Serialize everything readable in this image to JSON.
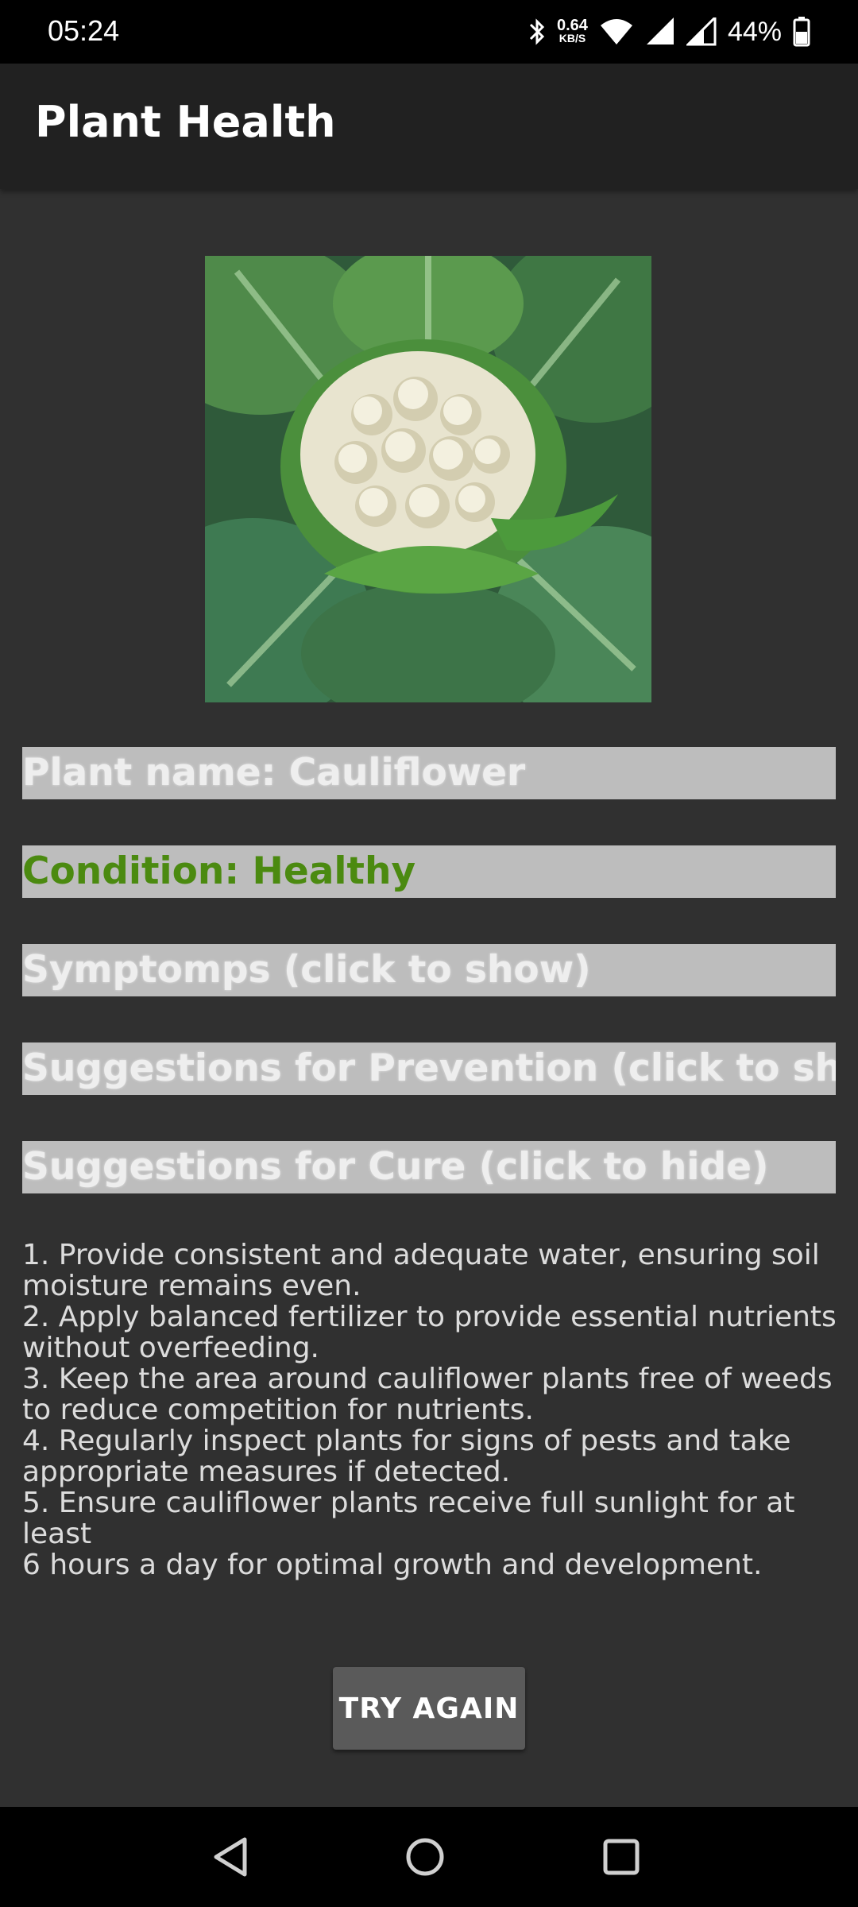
{
  "status_bar": {
    "time": "05:24",
    "net_speed_value": "0.64",
    "net_speed_unit": "KB/S",
    "battery_percent": "44%",
    "icons": [
      "bluetooth-icon",
      "wifi-icon",
      "signal-icon",
      "signal-icon-2",
      "battery-icon"
    ]
  },
  "app_bar": {
    "title": "Plant Health"
  },
  "result": {
    "plant_name_prefix": "Plant name: ",
    "plant_name": "Cauliflower",
    "condition_prefix": "Condition: ",
    "condition": "Healthy",
    "condition_color": "#4b8a10",
    "symptoms_label": "Symptomps (click to show)",
    "prevention_label": "Suggestions for Prevention (click to show)",
    "cure_label": "Suggestions for Cure (click to hide)",
    "cure_text": "1. Provide consistent and adequate water, ensuring soil moisture remains even.\n2. Apply balanced fertilizer to provide essential nutrients without overfeeding.\n3. Keep the area around cauliflower plants free of weeds to reduce competition for nutrients.\n4. Regularly inspect plants for signs of pests and take appropriate measures if detected.\n5. Ensure cauliflower plants receive full sunlight for at least\n6 hours a day for optimal growth and development."
  },
  "actions": {
    "try_again_label": "TRY AGAIN"
  },
  "nav_bar": {
    "icons": [
      "back-icon",
      "home-icon",
      "recents-icon"
    ]
  },
  "colors": {
    "background": "#303030",
    "app_bar": "#212121",
    "bar_bg": "#bdbdbd"
  }
}
